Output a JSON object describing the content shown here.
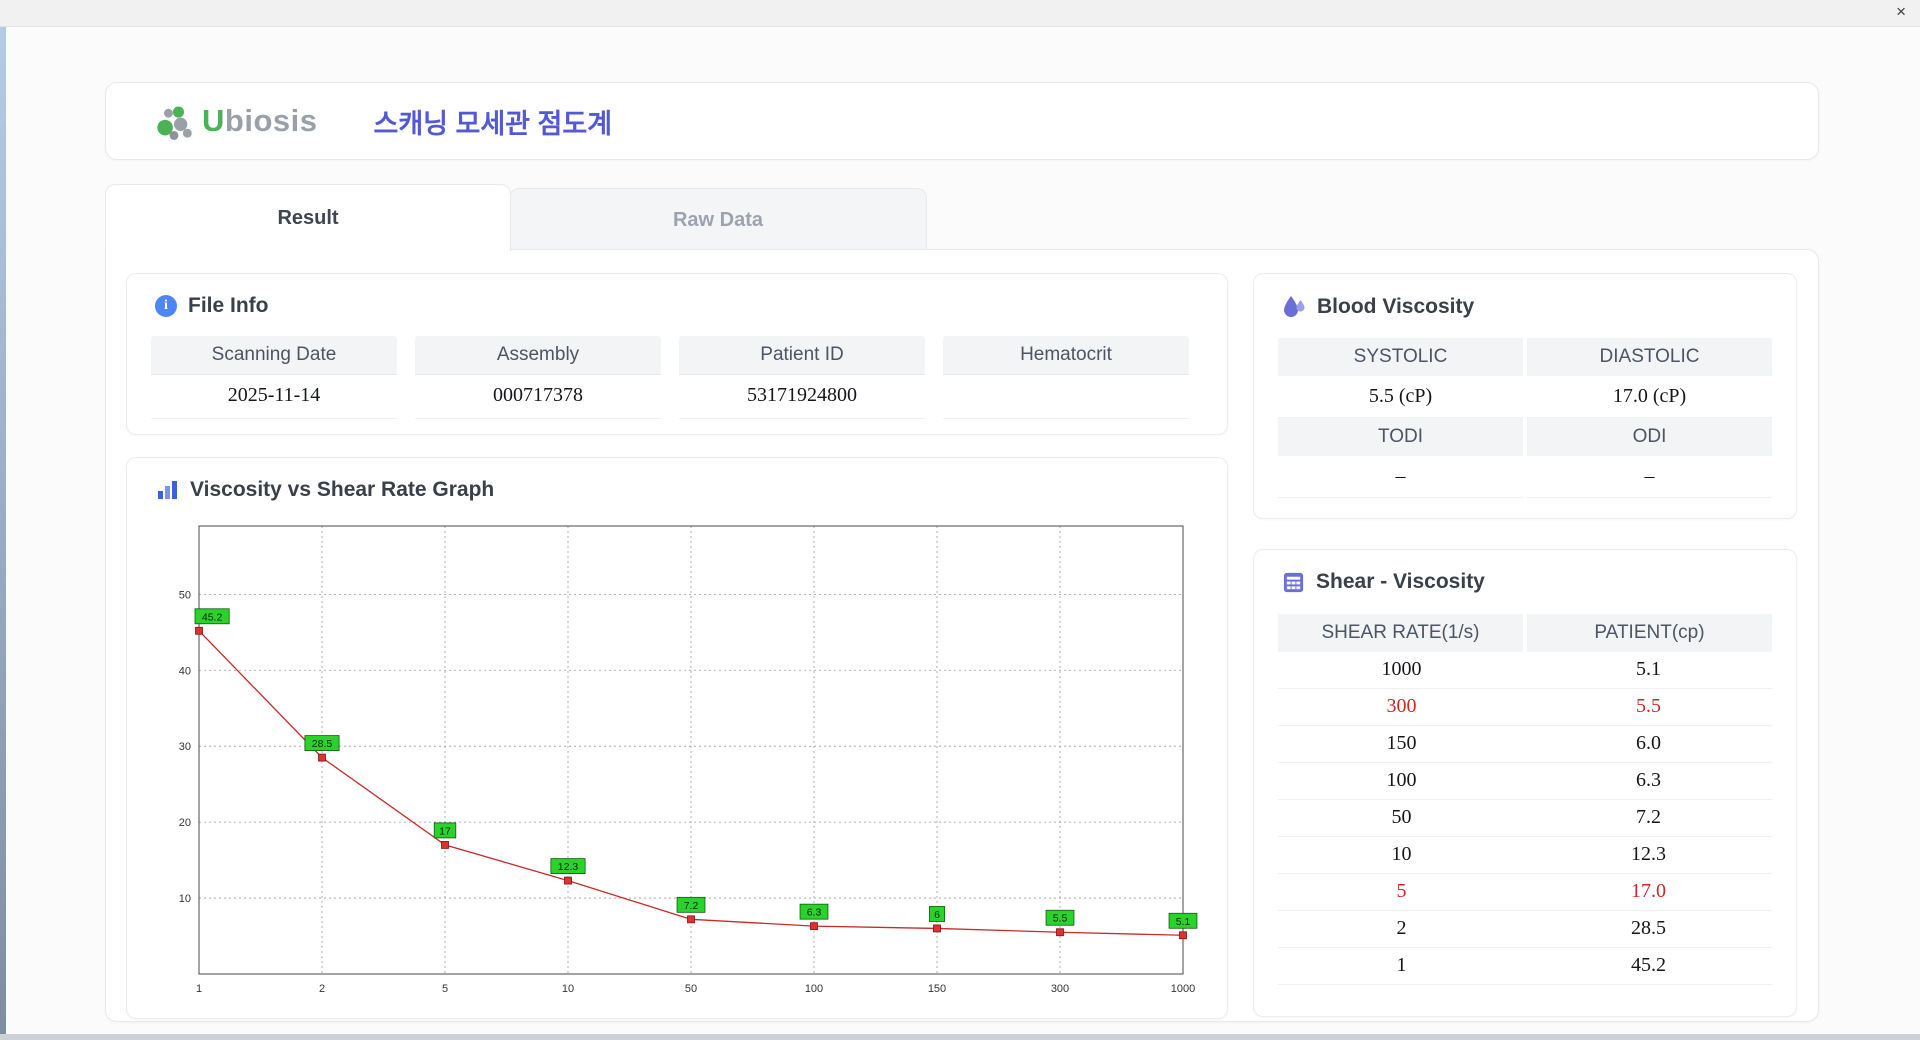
{
  "window": {
    "close_label": "×"
  },
  "header": {
    "brand_u": "U",
    "brand_rest": "biosis",
    "title": "스캐닝 모세관 점도계"
  },
  "tabs": [
    {
      "label": "Result",
      "active": true
    },
    {
      "label": "Raw Data",
      "active": false
    }
  ],
  "file_info": {
    "title": "File Info",
    "fields": [
      {
        "label": "Scanning Date",
        "value": "2025-11-14"
      },
      {
        "label": "Assembly",
        "value": "000717378"
      },
      {
        "label": "Patient ID",
        "value": "53171924800"
      },
      {
        "label": "Hematocrit",
        "value": ""
      }
    ]
  },
  "graph": {
    "title": "Viscosity vs Shear Rate Graph",
    "chart_data": {
      "type": "line",
      "title": "Viscosity vs Shear Rate Graph",
      "xlabel": "",
      "ylabel": "",
      "x_categories": [
        "1",
        "2",
        "5",
        "10",
        "50",
        "100",
        "150",
        "300",
        "1000"
      ],
      "values": [
        45.2,
        28.5,
        17,
        12.3,
        7.2,
        6.3,
        6,
        5.5,
        5.1
      ],
      "point_labels": [
        "45.2",
        "28.5",
        "17",
        "12.3",
        "7.2",
        "6.3",
        "6",
        "5.5",
        "5.1"
      ],
      "y_ticks": [
        10,
        20,
        30,
        40,
        50
      ],
      "ylim": [
        0,
        59
      ],
      "grid": "dashed",
      "line_color": "#c92a2a",
      "marker_color": "#e03131",
      "label_bg": "#2bd22b"
    }
  },
  "blood_viscosity": {
    "title": "Blood Viscosity",
    "cols": [
      {
        "header": "SYSTOLIC",
        "value": "5.5 (cP)"
      },
      {
        "header": "DIASTOLIC",
        "value": "17.0 (cP)"
      }
    ],
    "cols2": [
      {
        "header": "TODI",
        "value": "–"
      },
      {
        "header": "ODI",
        "value": "–"
      }
    ]
  },
  "shear_table": {
    "title": "Shear - Viscosity",
    "headers": [
      "SHEAR RATE(1/s)",
      "PATIENT(cp)"
    ],
    "rows": [
      {
        "rate": "1000",
        "patient": "5.1",
        "highlight": false
      },
      {
        "rate": "300",
        "patient": "5.5",
        "highlight": true
      },
      {
        "rate": "150",
        "patient": "6.0",
        "highlight": false
      },
      {
        "rate": "100",
        "patient": "6.3",
        "highlight": false
      },
      {
        "rate": "50",
        "patient": "7.2",
        "highlight": false
      },
      {
        "rate": "10",
        "patient": "12.3",
        "highlight": false
      },
      {
        "rate": "5",
        "patient": "17.0",
        "highlight": true
      },
      {
        "rate": "2",
        "patient": "28.5",
        "highlight": false
      },
      {
        "rate": "1",
        "patient": "45.2",
        "highlight": false
      }
    ]
  }
}
